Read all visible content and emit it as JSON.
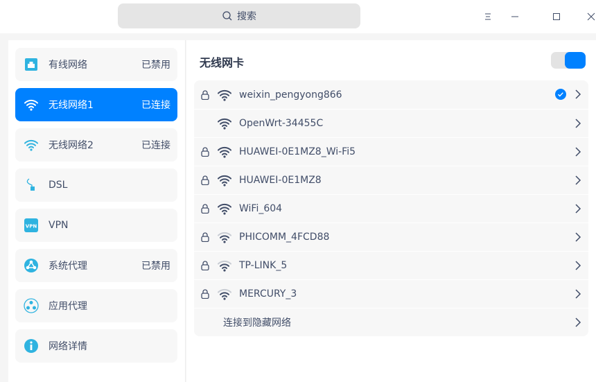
{
  "titlebar": {
    "search_placeholder": "搜索"
  },
  "colors": {
    "accent": "#0081ff",
    "icon": "#2fb3e0"
  },
  "sidebar": {
    "items": [
      {
        "label": "有线网络",
        "status": "已禁用",
        "icon": "wired-icon"
      },
      {
        "label": "无线网络1",
        "status": "已连接",
        "icon": "wifi-icon",
        "active": true
      },
      {
        "label": "无线网络2",
        "status": "已连接",
        "icon": "wifi-icon"
      },
      {
        "label": "DSL",
        "status": "",
        "icon": "dsl-icon"
      },
      {
        "label": "VPN",
        "status": "",
        "icon": "vpn-icon"
      },
      {
        "label": "系统代理",
        "status": "已禁用",
        "icon": "system-proxy-icon"
      },
      {
        "label": "应用代理",
        "status": "",
        "icon": "app-proxy-icon"
      },
      {
        "label": "网络详情",
        "status": "",
        "icon": "info-icon"
      }
    ]
  },
  "main": {
    "title": "无线网卡",
    "toggle_on": true,
    "networks": [
      {
        "ssid": "weixin_pengyong866",
        "secured": true,
        "strength": 3,
        "connected": true
      },
      {
        "ssid": "OpenWrt-34455C",
        "secured": false,
        "strength": 3,
        "connected": false
      },
      {
        "ssid": "HUAWEI-0E1MZ8_Wi-Fi5",
        "secured": true,
        "strength": 3,
        "connected": false
      },
      {
        "ssid": "HUAWEI-0E1MZ8",
        "secured": true,
        "strength": 3,
        "connected": false
      },
      {
        "ssid": "WiFi_604",
        "secured": true,
        "strength": 3,
        "connected": false
      },
      {
        "ssid": "PHICOMM_4FCD88",
        "secured": true,
        "strength": 2,
        "connected": false
      },
      {
        "ssid": "TP-LINK_5",
        "secured": true,
        "strength": 2,
        "connected": false
      },
      {
        "ssid": "MERCURY_3",
        "secured": true,
        "strength": 2,
        "connected": false
      }
    ],
    "hidden_network_label": "连接到隐藏网络"
  }
}
